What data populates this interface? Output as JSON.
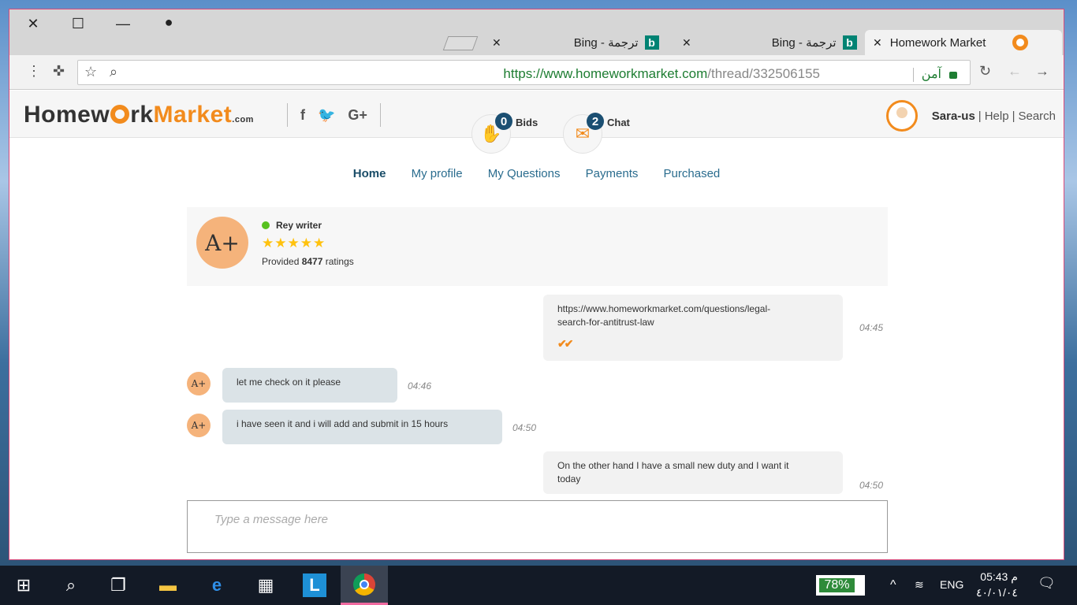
{
  "browser": {
    "tabs": [
      {
        "title": "Homework Market",
        "active": true
      },
      {
        "title": "Bing - ترجمة",
        "active": false
      },
      {
        "title": "Bing - ترجمة",
        "active": false
      }
    ],
    "url_scheme": "https://",
    "url_host": "www.homeworkmarket.com",
    "url_path": "/thread/332506155",
    "secure_label": "آمن"
  },
  "site": {
    "logo_homew": "Homew",
    "logo_rk": "rk",
    "logo_market": "Market",
    "logo_com": ".com",
    "bids_count": "0",
    "bids_label": "Bids",
    "chat_count": "2",
    "chat_label": "Chat",
    "username": "Sara-us",
    "help": "Help",
    "search": "Search",
    "divider": "|"
  },
  "nav": [
    "Home",
    "My profile",
    "My Questions",
    "Payments",
    "Purchased"
  ],
  "profile": {
    "name": "Rey writer",
    "stars": "★★★★★",
    "ratings_prefix": "Provided ",
    "ratings_count": "8477",
    "ratings_suffix": " ratings",
    "avatar_text": "A+"
  },
  "messages": [
    {
      "side": "out",
      "line1": "https://www.homeworkmarket.com/questions/legal-",
      "line2": "search-for-antitrust-law",
      "time": "04:45",
      "checks": "✔✔"
    },
    {
      "side": "in",
      "text": "let me check on it please",
      "time": "04:46"
    },
    {
      "side": "in",
      "text": "i have seen it and i will add and submit in 15 hours",
      "time": "04:50"
    },
    {
      "side": "out",
      "line1": "On the other hand I have a small new duty and I want it",
      "line2": "today",
      "time": "04:50"
    }
  ],
  "composer": {
    "placeholder": "Type a message here"
  },
  "taskbar": {
    "battery": "78%",
    "battery_level": 0.78,
    "language": "ENG",
    "time": "05:43 م",
    "date": "٤٠/٠١/٠٤"
  }
}
